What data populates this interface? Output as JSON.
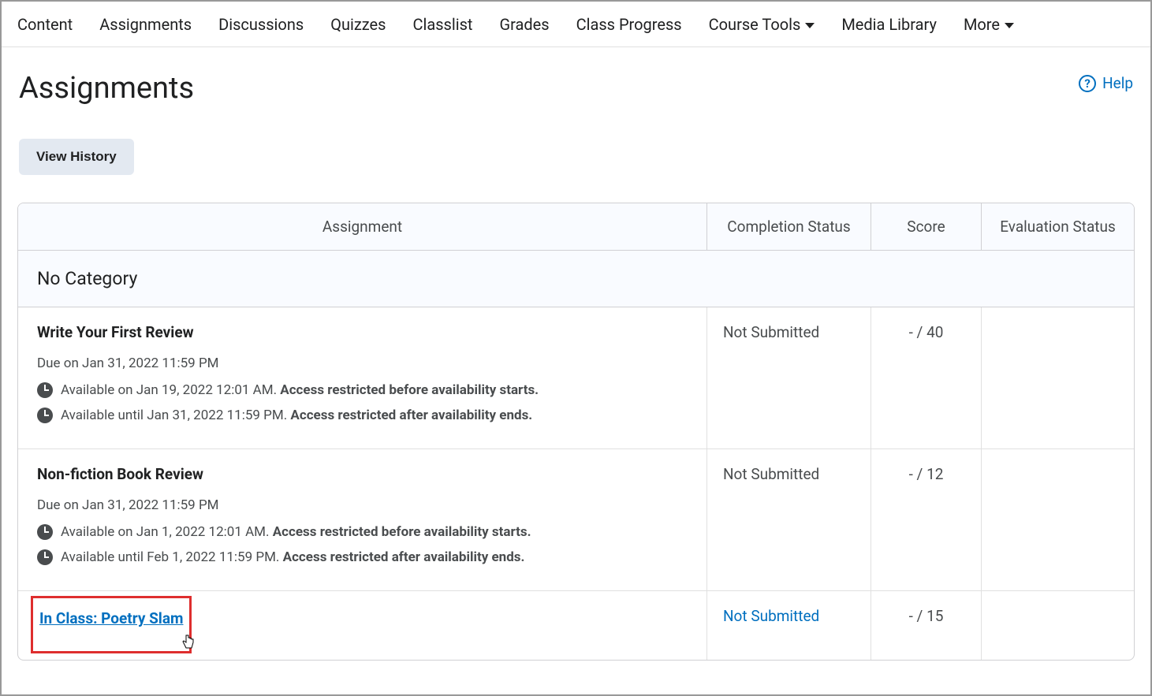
{
  "nav": {
    "items": [
      {
        "label": "Content",
        "hasDropdown": false
      },
      {
        "label": "Assignments",
        "hasDropdown": false
      },
      {
        "label": "Discussions",
        "hasDropdown": false
      },
      {
        "label": "Quizzes",
        "hasDropdown": false
      },
      {
        "label": "Classlist",
        "hasDropdown": false
      },
      {
        "label": "Grades",
        "hasDropdown": false
      },
      {
        "label": "Class Progress",
        "hasDropdown": false
      },
      {
        "label": "Course Tools",
        "hasDropdown": true
      },
      {
        "label": "Media Library",
        "hasDropdown": false
      },
      {
        "label": "More",
        "hasDropdown": true
      }
    ]
  },
  "header": {
    "title": "Assignments",
    "helpLabel": "Help"
  },
  "buttons": {
    "viewHistory": "View History"
  },
  "table": {
    "headers": {
      "assignment": "Assignment",
      "completion": "Completion Status",
      "score": "Score",
      "evaluation": "Evaluation Status"
    },
    "category": "No Category",
    "rows": [
      {
        "title": "Write Your First Review",
        "isLink": false,
        "due": "Due on Jan 31, 2022 11:59 PM",
        "avail1": "Available on Jan 19, 2022 12:01 AM. ",
        "avail1bold": "Access restricted before availability starts.",
        "avail2": "Available until Jan 31, 2022 11:59 PM. ",
        "avail2bold": "Access restricted after availability ends.",
        "status": "Not Submitted",
        "statusLink": false,
        "score": "- / 40"
      },
      {
        "title": "Non-fiction Book Review",
        "isLink": false,
        "due": "Due on Jan 31, 2022 11:59 PM",
        "avail1": "Available on Jan 1, 2022 12:01 AM. ",
        "avail1bold": "Access restricted before availability starts.",
        "avail2": "Available until Feb 1, 2022 11:59 PM. ",
        "avail2bold": "Access restricted after availability ends.",
        "status": "Not Submitted",
        "statusLink": false,
        "score": "- / 12"
      },
      {
        "title": "In Class: Poetry Slam",
        "isLink": true,
        "highlighted": true,
        "status": "Not Submitted",
        "statusLink": true,
        "score": "- / 15"
      }
    ]
  }
}
